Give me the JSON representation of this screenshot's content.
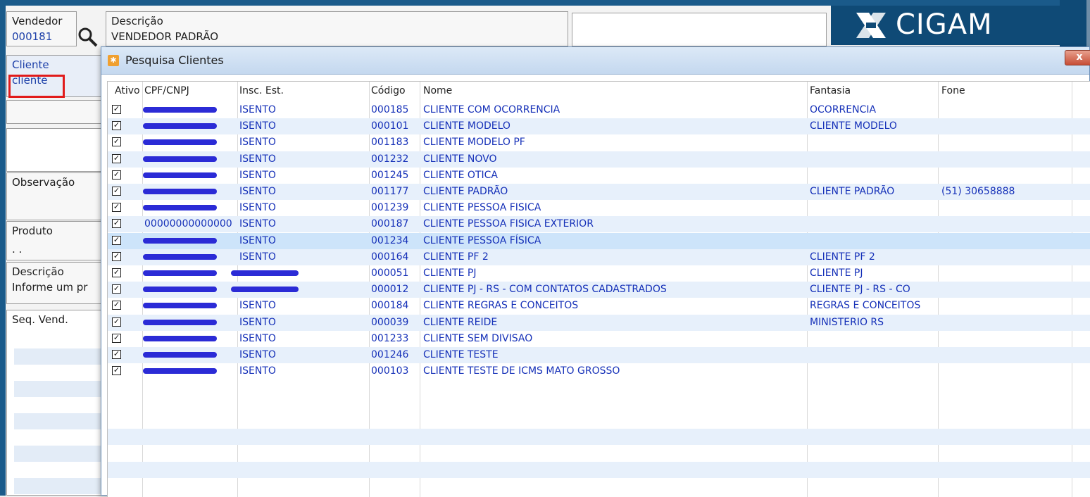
{
  "background": {
    "vendedor_label": "Vendedor",
    "vendedor_code": "000181",
    "descricao_label": "Descrição",
    "descricao_value": "VENDEDOR PADRÃO",
    "cliente_label": "Cliente",
    "cliente_value": "cliente",
    "observacao_label": "Observação",
    "produto_label": "Produto",
    "produto_value": ". .",
    "descricao2_label": "Descrição",
    "descricao2_value": "Informe um pr",
    "seq_label": "Seq.  Vend.",
    "logo_text": "CIGAM",
    "colors": {
      "frame": "#1a5a8a",
      "logo_bg": "#0f4a76",
      "highlight": "#e11b1b"
    }
  },
  "dialog": {
    "title": "Pesquisa Clientes",
    "close_label": "x",
    "columns": [
      "Ativo",
      "CPF/CNPJ",
      "Insc. Est.",
      "Código",
      "Nome",
      "Fantasia",
      "Fone"
    ],
    "rows": [
      {
        "cpf": "",
        "insc": "ISENTO",
        "codigo": "000185",
        "nome": "CLIENTE COM OCORRENCIA",
        "fantasia": "OCORRENCIA",
        "fone": ""
      },
      {
        "cpf": "",
        "insc": "ISENTO",
        "codigo": "000101",
        "nome": "CLIENTE MODELO",
        "fantasia": "CLIENTE MODELO",
        "fone": ""
      },
      {
        "cpf": "",
        "insc": "ISENTO",
        "codigo": "001183",
        "nome": "CLIENTE MODELO PF",
        "fantasia": "",
        "fone": ""
      },
      {
        "cpf": "",
        "insc": "ISENTO",
        "codigo": "001232",
        "nome": "CLIENTE NOVO",
        "fantasia": "",
        "fone": ""
      },
      {
        "cpf": "",
        "insc": "ISENTO",
        "codigo": "001245",
        "nome": "CLIENTE OTICA",
        "fantasia": "",
        "fone": ""
      },
      {
        "cpf": "",
        "insc": "ISENTO",
        "codigo": "001177",
        "nome": "CLIENTE PADRÃO",
        "fantasia": "CLIENTE PADRÃO",
        "fone": "(51) 30658888"
      },
      {
        "cpf": "",
        "insc": "ISENTO",
        "codigo": "001239",
        "nome": "CLIENTE PESSOA FISICA",
        "fantasia": "",
        "fone": ""
      },
      {
        "cpf": "00000000000000",
        "insc": "ISENTO",
        "codigo": "000187",
        "nome": "CLIENTE PESSOA FISICA EXTERIOR",
        "fantasia": "",
        "fone": ""
      },
      {
        "cpf": "",
        "insc": "ISENTO",
        "codigo": "001234",
        "nome": "CLIENTE PESSOA FÍSICA",
        "fantasia": "",
        "fone": ""
      },
      {
        "cpf": "",
        "insc": "ISENTO",
        "codigo": "000164",
        "nome": "CLIENTE PF 2",
        "fantasia": "CLIENTE PF 2",
        "fone": ""
      },
      {
        "cpf": "",
        "insc": "",
        "codigo": "000051",
        "nome": "CLIENTE PJ",
        "fantasia": "CLIENTE PJ",
        "fone": ""
      },
      {
        "cpf": "",
        "insc": "",
        "codigo": "000012",
        "nome": "CLIENTE PJ - RS - COM CONTATOS CADASTRADOS",
        "fantasia": "CLIENTE PJ - RS - CO",
        "fone": ""
      },
      {
        "cpf": "",
        "insc": "ISENTO",
        "codigo": "000184",
        "nome": "CLIENTE REGRAS E CONCEITOS",
        "fantasia": "REGRAS E CONCEITOS",
        "fone": ""
      },
      {
        "cpf": "",
        "insc": "ISENTO",
        "codigo": "000039",
        "nome": "CLIENTE REIDE",
        "fantasia": "MINISTERIO RS",
        "fone": ""
      },
      {
        "cpf": "",
        "insc": "ISENTO",
        "codigo": "001233",
        "nome": "CLIENTE SEM DIVISAO",
        "fantasia": "",
        "fone": ""
      },
      {
        "cpf": "",
        "insc": "ISENTO",
        "codigo": "001246",
        "nome": "CLIENTE TESTE",
        "fantasia": "",
        "fone": ""
      },
      {
        "cpf": "",
        "insc": "ISENTO",
        "codigo": "000103",
        "nome": "CLIENTE TESTE DE ICMS MATO GROSSO",
        "fantasia": "",
        "fone": ""
      }
    ],
    "colors": {
      "text": "#1530b8",
      "alt_row": "#e7f0fb",
      "selected_row": "#cde4fa",
      "title_bar": "#c4d8ef"
    }
  }
}
